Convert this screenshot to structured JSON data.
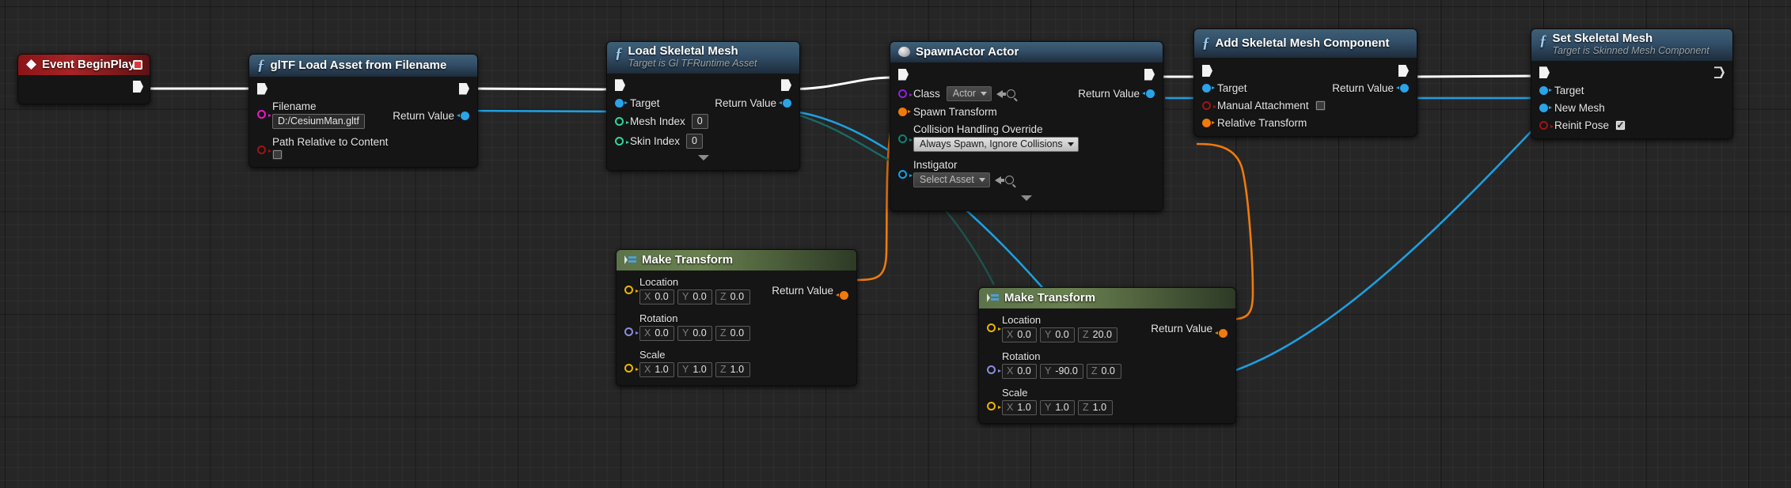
{
  "app": {
    "view": "blueprint-graph"
  },
  "nodes": {
    "event_beginplay": {
      "title": "Event BeginPlay",
      "icon": "event-diamond-icon",
      "badge": "stop-icon"
    },
    "gltf_load_asset": {
      "title": "glTF Load Asset from Filename",
      "icon": "function-f-icon",
      "pins": {
        "filename_label": "Filename",
        "filename_value": "D:/CesiumMan.gltf",
        "path_relative_label": "Path Relative to Content",
        "path_relative_checked": false,
        "return_value_label": "Return Value"
      }
    },
    "load_skeletal_mesh": {
      "title": "Load Skeletal Mesh",
      "subtitle": "Target is Gl TFRuntime Asset",
      "icon": "function-f-icon",
      "pins": {
        "target_label": "Target",
        "mesh_index_label": "Mesh Index",
        "mesh_index_value": "0",
        "skin_index_label": "Skin Index",
        "skin_index_value": "0",
        "return_value_label": "Return Value"
      }
    },
    "spawn_actor": {
      "title": "SpawnActor Actor",
      "icon": "actor-icon",
      "pins": {
        "class_label": "Class",
        "class_value": "Actor",
        "spawn_transform_label": "Spawn Transform",
        "collision_label": "Collision Handling Override",
        "collision_value": "Always Spawn, Ignore Collisions",
        "instigator_label": "Instigator",
        "instigator_value": "Select Asset",
        "return_value_label": "Return Value"
      }
    },
    "add_skeletal_mesh_component": {
      "title": "Add Skeletal Mesh Component",
      "icon": "function-f-icon",
      "pins": {
        "target_label": "Target",
        "manual_attachment_label": "Manual Attachment",
        "manual_attachment_checked": false,
        "relative_transform_label": "Relative Transform",
        "return_value_label": "Return Value"
      }
    },
    "set_skeletal_mesh": {
      "title": "Set Skeletal Mesh",
      "subtitle": "Target is Skinned Mesh Component",
      "icon": "function-f-icon",
      "pins": {
        "target_label": "Target",
        "new_mesh_label": "New Mesh",
        "reinit_pose_label": "Reinit Pose",
        "reinit_pose_checked": true
      }
    },
    "make_transform_1": {
      "title": "Make Transform",
      "icon": "make-transform-icon",
      "pins": {
        "location_label": "Location",
        "location": {
          "x": "0.0",
          "y": "0.0",
          "z": "0.0"
        },
        "rotation_label": "Rotation",
        "rotation": {
          "x": "0.0",
          "y": "0.0",
          "z": "0.0"
        },
        "scale_label": "Scale",
        "scale": {
          "x": "1.0",
          "y": "1.0",
          "z": "1.0"
        },
        "return_value_label": "Return Value"
      }
    },
    "make_transform_2": {
      "title": "Make Transform",
      "icon": "make-transform-icon",
      "pins": {
        "location_label": "Location",
        "location": {
          "x": "0.0",
          "y": "0.0",
          "z": "20.0"
        },
        "rotation_label": "Rotation",
        "rotation": {
          "x": "0.0",
          "y": "-90.0",
          "z": "0.0"
        },
        "scale_label": "Scale",
        "scale": {
          "x": "1.0",
          "y": "1.0",
          "z": "1.0"
        },
        "return_value_label": "Return Value"
      }
    }
  },
  "axes": {
    "x": "X",
    "y": "Y",
    "z": "Z"
  },
  "colors": {
    "exec_wire": "#ffffff",
    "object_wire": "#1e9fe0",
    "transform_wire": "#f07a0c",
    "enum_wire": "#0d8374",
    "canvas": "#262626",
    "node_body": "#151515",
    "title_function": "#33506a",
    "title_event": "#a82426",
    "title_pure": "#69804f"
  }
}
